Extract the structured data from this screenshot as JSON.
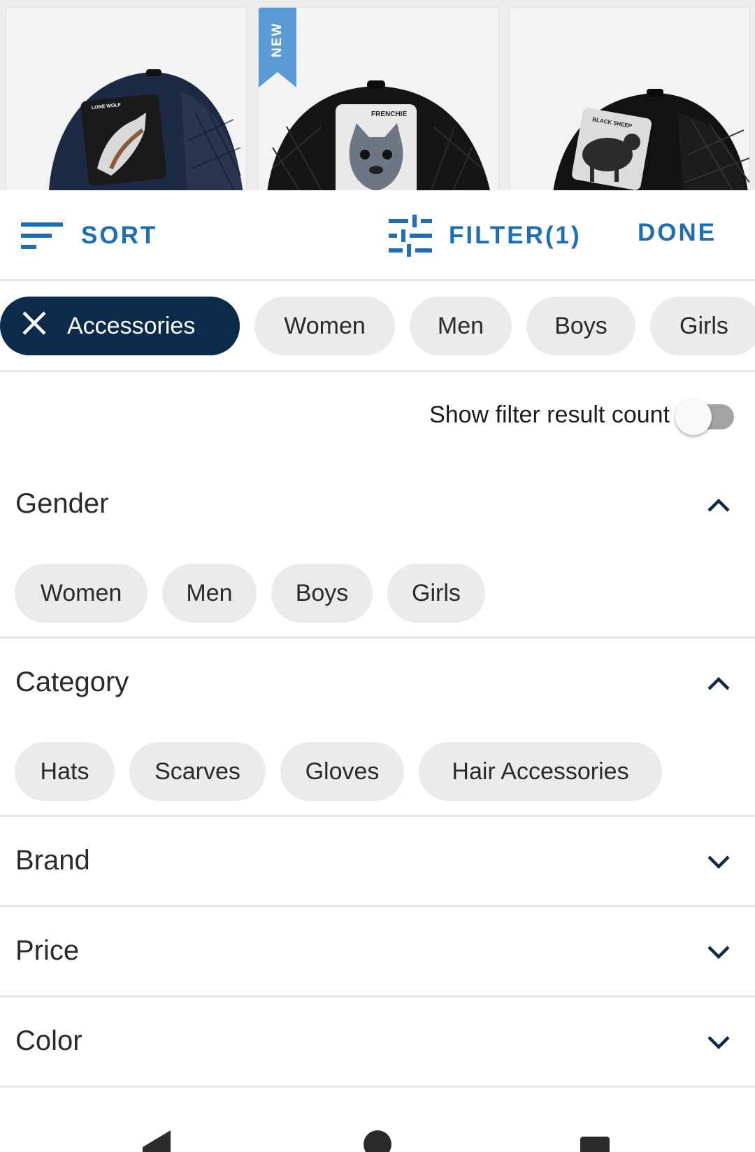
{
  "products": [
    {
      "patch_text": "LONE WOLF",
      "badge": ""
    },
    {
      "patch_text": "FRENCHIE",
      "badge": "NEW"
    },
    {
      "patch_text": "BLACK SHEEP",
      "badge": ""
    }
  ],
  "toolbar": {
    "sort_label": "SORT",
    "filter_label": "FILTER(1)",
    "done_label": "DONE"
  },
  "chips": {
    "active": "Accessories",
    "items": [
      "Women",
      "Men",
      "Boys",
      "Girls"
    ]
  },
  "toggle": {
    "label": "Show filter result count",
    "on": false
  },
  "sections": {
    "gender": {
      "title": "Gender",
      "expanded": true,
      "options": [
        "Women",
        "Men",
        "Boys",
        "Girls"
      ]
    },
    "category": {
      "title": "Category",
      "expanded": true,
      "options": [
        "Hats",
        "Scarves",
        "Gloves",
        "Hair Accessories"
      ]
    },
    "brand": {
      "title": "Brand",
      "expanded": false
    },
    "price": {
      "title": "Price",
      "expanded": false
    },
    "color": {
      "title": "Color",
      "expanded": false
    }
  },
  "colors": {
    "accent": "#1f6db3",
    "active_chip": "#0c2b4b",
    "chip_bg": "#ebebeb",
    "ribbon": "#5b9bd5"
  },
  "icons": [
    "sort-icon",
    "filter-sliders-icon",
    "close-icon",
    "chevron-up-icon",
    "chevron-down-icon",
    "back-triangle-icon",
    "home-circle-icon",
    "recents-square-icon"
  ]
}
